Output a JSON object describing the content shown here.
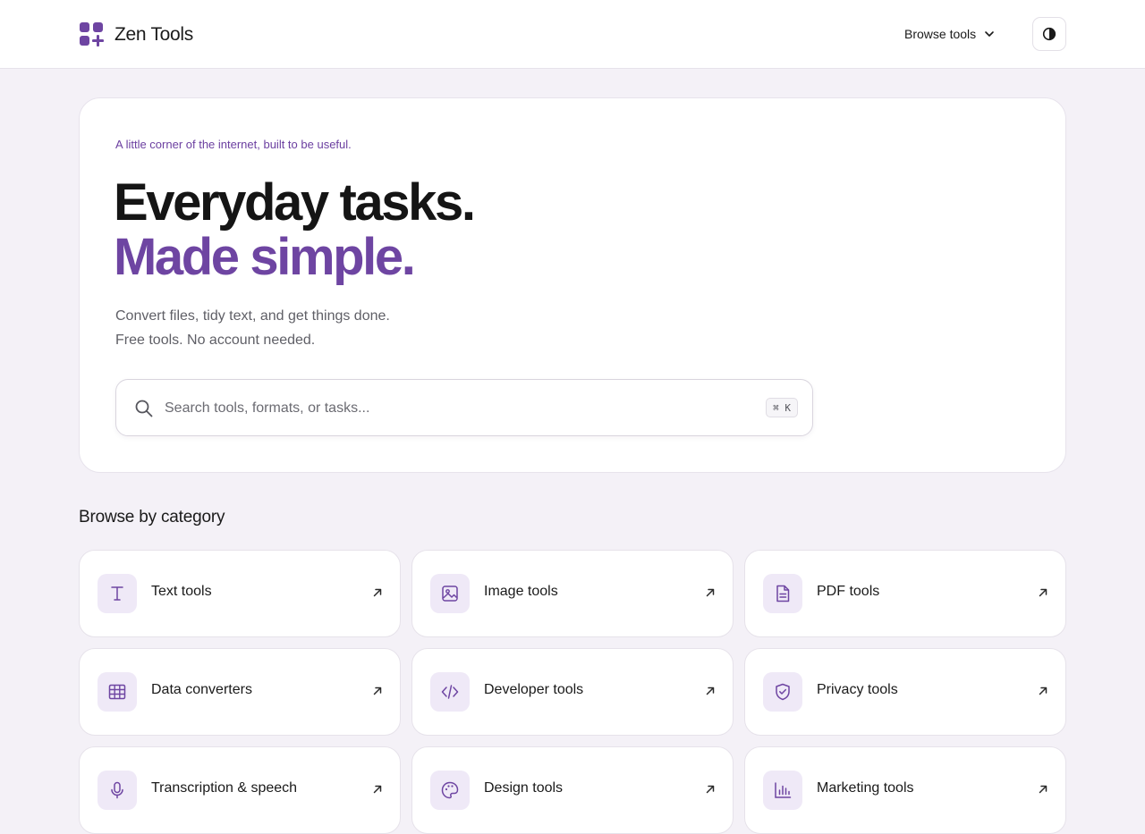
{
  "header": {
    "brand": "Zen Tools",
    "browse_label": "Browse tools"
  },
  "hero": {
    "eyebrow": "A little corner of the internet, built to be useful.",
    "title_line1": "Everyday tasks.",
    "title_line2": "Made simple.",
    "sub_line1": "Convert files, tidy text, and get things done.",
    "sub_line2": "Free tools. No account needed.",
    "search_placeholder": "Search tools, formats, or tasks...",
    "shortcut": "⌘ K"
  },
  "categories": {
    "title": "Browse by category",
    "items": [
      {
        "label": "Text tools",
        "icon": "text-icon"
      },
      {
        "label": "Image tools",
        "icon": "image-icon"
      },
      {
        "label": "PDF tools",
        "icon": "document-icon"
      },
      {
        "label": "Data converters",
        "icon": "table-icon"
      },
      {
        "label": "Developer tools",
        "icon": "code-icon"
      },
      {
        "label": "Privacy tools",
        "icon": "shield-check-icon"
      },
      {
        "label": "Transcription & speech",
        "icon": "microphone-icon"
      },
      {
        "label": "Design tools",
        "icon": "palette-icon"
      },
      {
        "label": "Marketing tools",
        "icon": "bar-chart-icon"
      }
    ]
  },
  "colors": {
    "accent": "#6e45a2",
    "accent_soft": "#efe9f7",
    "page_bg": "#f4f1f7"
  }
}
